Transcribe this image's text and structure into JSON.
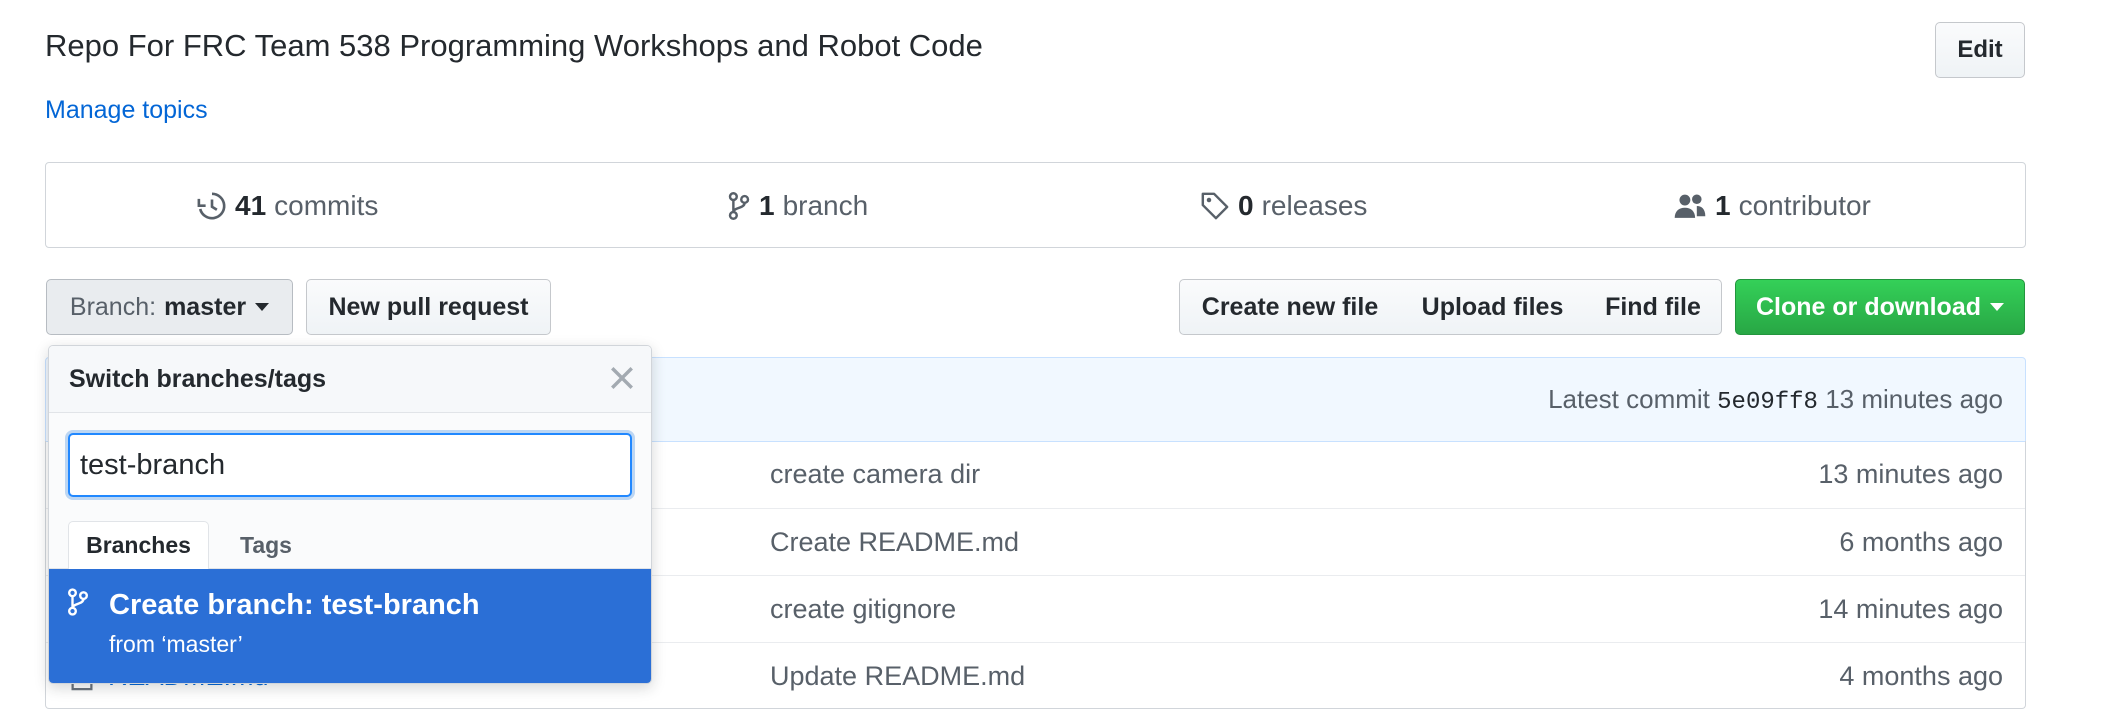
{
  "repo": {
    "description": "Repo For FRC Team 538 Programming Workshops and Robot Code",
    "manage_topics": "Manage topics",
    "edit_label": "Edit"
  },
  "summary": {
    "commits_count": "41",
    "commits_label": "commits",
    "branches_count": "1",
    "branches_label": "branch",
    "releases_count": "0",
    "releases_label": "releases",
    "contributors_count": "1",
    "contributors_label": "contributor"
  },
  "toolbar": {
    "branch_prefix": "Branch:",
    "branch_value": "master",
    "new_pr": "New pull request",
    "create_new_file": "Create new file",
    "upload_files": "Upload files",
    "find_file": "Find file",
    "clone_download": "Clone or download"
  },
  "commit_bar": {
    "latest_label": "Latest commit",
    "sha": "5e09ff8",
    "age": "13 minutes ago"
  },
  "files": [
    {
      "message": "create camera dir",
      "age": "13 minutes ago"
    },
    {
      "message": "Create README.md",
      "age": "6 months ago"
    },
    {
      "message": "create gitignore",
      "age": "14 minutes ago"
    },
    {
      "name": "README.md",
      "message": "Update README.md",
      "age": "4 months ago"
    }
  ],
  "dropdown": {
    "title": "Switch branches/tags",
    "filter_value": "test-branch",
    "tabs": [
      "Branches",
      "Tags"
    ],
    "create_title": "Create branch: test-branch",
    "create_from": "from ‘master’"
  },
  "colors": {
    "link": "#0366d6",
    "clone_green": "#28a745",
    "dropdown_highlight": "#2b6fd6",
    "commit_bar_bg": "#f1f8ff"
  }
}
